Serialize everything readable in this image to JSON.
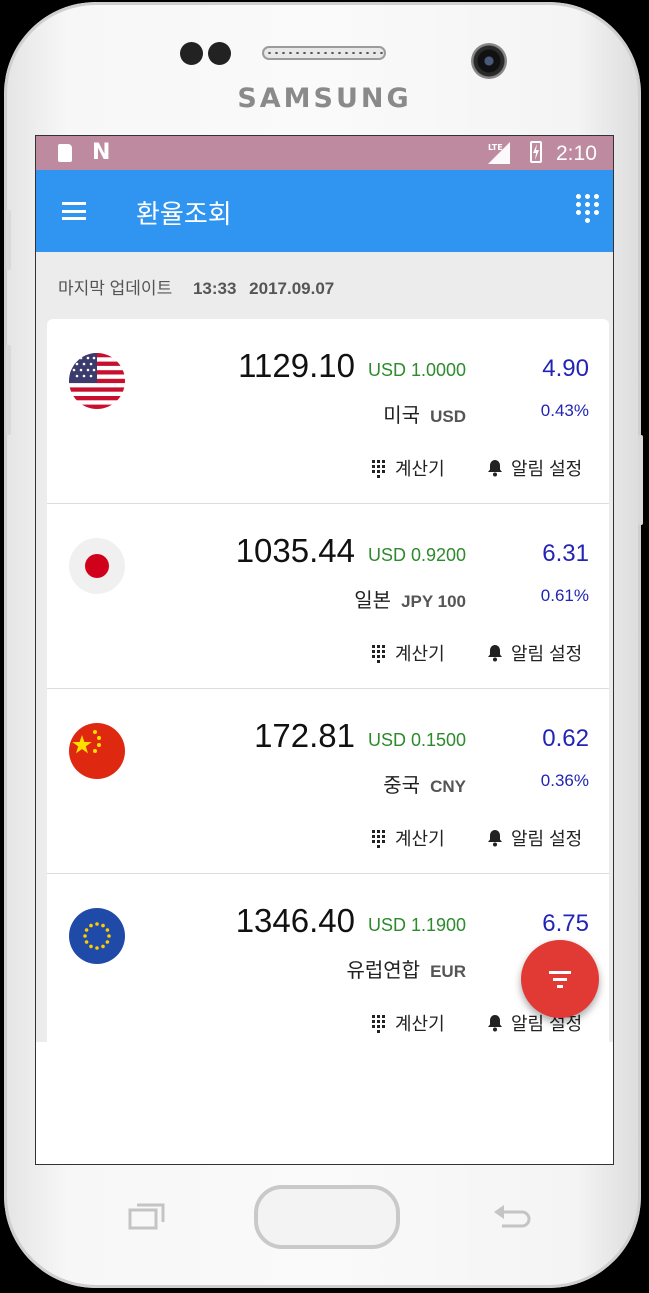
{
  "device": {
    "brand": "SAMSUNG"
  },
  "status_bar": {
    "time": "2:10",
    "network": "LTE",
    "notification_icon": "N",
    "bg_color": "#be8a9f"
  },
  "app_bar": {
    "title": "환율조회",
    "menu_icon": "hamburger-menu-icon",
    "action_icon": "dialpad-icon",
    "color": "#2f95f1"
  },
  "last_update": {
    "label": "마지막 업데이트",
    "time": "13:33",
    "date": "2017.09.07"
  },
  "currencies": [
    {
      "flag": "us-flag-icon",
      "rate": "1129.10",
      "base": "USD 1.0000",
      "country": "미국",
      "code": "USD",
      "change": "4.90",
      "change_pct": "0.43%",
      "calc_label": "계산기",
      "alarm_label": "알림 설정"
    },
    {
      "flag": "jp-flag-icon",
      "rate": "1035.44",
      "base": "USD 0.9200",
      "country": "일본",
      "code": "JPY 100",
      "change": "6.31",
      "change_pct": "0.61%",
      "calc_label": "계산기",
      "alarm_label": "알림 설정"
    },
    {
      "flag": "cn-flag-icon",
      "rate": "172.81",
      "base": "USD 0.1500",
      "country": "중국",
      "code": "CNY",
      "change": "0.62",
      "change_pct": "0.36%",
      "calc_label": "계산기",
      "alarm_label": "알림 설정"
    },
    {
      "flag": "eu-flag-icon",
      "rate": "1346.40",
      "base": "USD 1.1900",
      "country": "유럽연합",
      "code": "EUR",
      "change": "6.75",
      "change_pct": "",
      "calc_label": "계산기",
      "alarm_label": "알림 설정"
    }
  ],
  "fab": {
    "icon": "filter-icon",
    "color": "#e13a34"
  },
  "colors": {
    "rate_change": "#2224b5",
    "base_rate": "#2d8a2d"
  }
}
